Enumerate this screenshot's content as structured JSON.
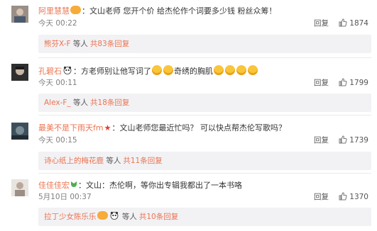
{
  "comments": [
    {
      "username": "阿里慧慧",
      "text": "：文山老师 您开个价 给杰伦作个词要多少钱 粉丝众筹！",
      "time": "今天 00:22",
      "reply_label": "回复",
      "likes": "1874",
      "sub_user": "熊芬X-F",
      "sub_suffix": "等人",
      "sub_count": "共83条回复"
    },
    {
      "username": "孔碧石",
      "text_a": "：方老师别让他写词了",
      "text_b": "奇绣的胸肌",
      "time": "今天 00:11",
      "reply_label": "回复",
      "likes": "1799",
      "sub_user": "Alex-F_",
      "sub_suffix": "等人",
      "sub_count": "共18条回复"
    },
    {
      "username": "最美不是下雨天fm",
      "text": "：文山老师您最近忙吗？ 可以快点帮杰伦写歌吗？",
      "time": "今天 00:15",
      "reply_label": "回复",
      "likes": "1739",
      "sub_user": "诗心纸上的梅花鹿",
      "sub_suffix": "等人",
      "sub_count": "共11条回复"
    },
    {
      "username": "佳佳佳宏",
      "text": "：文山：杰伦啊，等你出专辑我都出了一本书咯",
      "time": "5月10日 00:37",
      "reply_label": "回复",
      "likes": "1370",
      "sub_user": "拉丁少女陈乐乐",
      "sub_suffix": "等人",
      "sub_count": "共10条回复"
    }
  ],
  "colors": {
    "username": "#eb7350",
    "text": "#333333",
    "meta": "#808080",
    "sub_bg": "#f2f2f5"
  },
  "icons": [
    "thumb-up-icon",
    "panda-icon",
    "vip-badge-icon",
    "emoji-laugh-icon",
    "star-badge-icon",
    "green-badge-icon"
  ]
}
